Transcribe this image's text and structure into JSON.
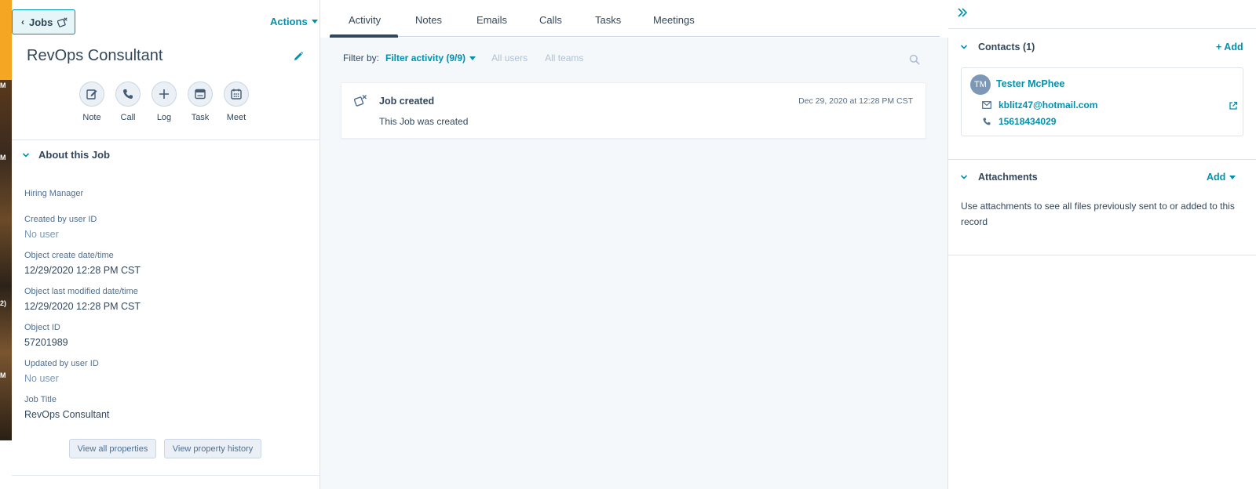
{
  "colors": {
    "accent": "#0091ae",
    "text": "#33475b",
    "muted": "#7c98b6",
    "disabled": "#b0c1d4",
    "border": "#dfe3eb",
    "panel_bg": "#f5f8fa",
    "chip_bg": "#eaf0f6",
    "edge_orange": "#f5a623"
  },
  "edge_fragments": [
    "M",
    "M",
    "2)",
    "M"
  ],
  "left": {
    "back_button": {
      "label": "Jobs",
      "chevron": "‹",
      "icon": "job-icon"
    },
    "actions_label": "Actions",
    "record_title": "RevOps Consultant",
    "quick_actions": [
      {
        "label": "Note",
        "icon": "note-icon"
      },
      {
        "label": "Call",
        "icon": "phone-icon"
      },
      {
        "label": "Log",
        "icon": "plus-icon"
      },
      {
        "label": "Task",
        "icon": "task-icon"
      },
      {
        "label": "Meet",
        "icon": "calendar-icon"
      }
    ],
    "about_title": "About this Job",
    "properties": [
      {
        "label": "Hiring Manager",
        "value": ""
      },
      {
        "label": "Created by user ID",
        "value": "No user"
      },
      {
        "label": "Object create date/time",
        "value": "12/29/2020 12:28 PM CST"
      },
      {
        "label": "Object last modified date/time",
        "value": "12/29/2020 12:28 PM CST"
      },
      {
        "label": "Object ID",
        "value": "57201989"
      },
      {
        "label": "Updated by user ID",
        "value": "No user"
      },
      {
        "label": "Job Title",
        "value": "RevOps Consultant"
      }
    ],
    "view_all_label": "View all properties",
    "view_history_label": "View property history"
  },
  "middle": {
    "tabs": [
      "Activity",
      "Notes",
      "Emails",
      "Calls",
      "Tasks",
      "Meetings"
    ],
    "active_tab": "Activity",
    "filter_label": "Filter by:",
    "filter_activity": "Filter activity (9/9)",
    "all_users": "All users",
    "all_teams": "All teams",
    "event": {
      "title": "Job created",
      "date": "Dec 29, 2020 at 12:28 PM CST",
      "body": "This Job was created"
    }
  },
  "right": {
    "contacts_title": "Contacts (1)",
    "contacts_add": "+ Add",
    "contact": {
      "initials": "TM",
      "name": "Tester McPhee",
      "email": "kblitz47@hotmail.com",
      "phone": "15618434029"
    },
    "attachments_title": "Attachments",
    "attachments_add": "Add",
    "attachments_text": "Use attachments to see all files previously sent to or added to this record"
  }
}
